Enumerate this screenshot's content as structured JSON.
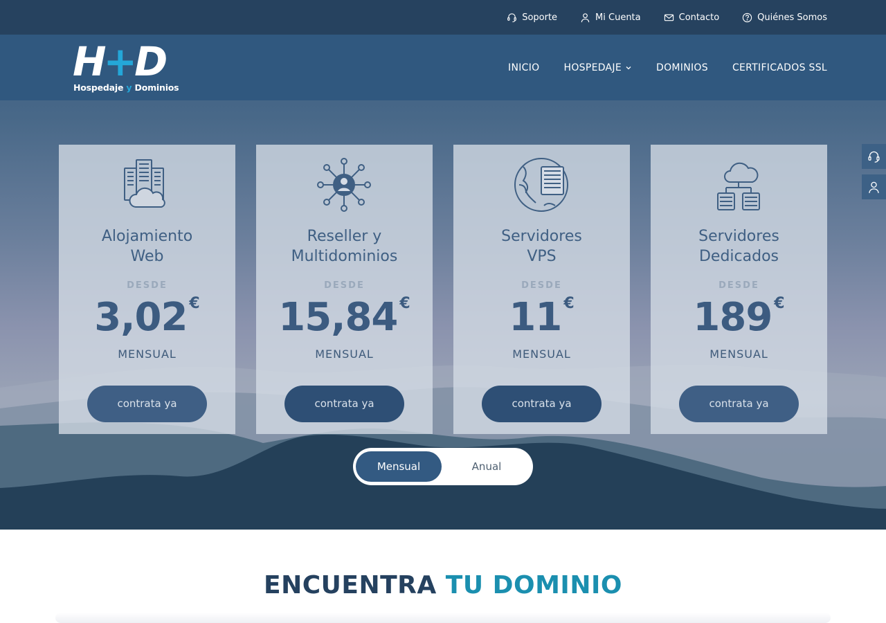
{
  "topbar": {
    "links": [
      {
        "label": "Soporte",
        "icon": "headset-icon"
      },
      {
        "label": "Mi Cuenta",
        "icon": "user-icon"
      },
      {
        "label": "Contacto",
        "icon": "envelope-icon"
      },
      {
        "label": "Quiénes Somos",
        "icon": "question-circle-icon"
      }
    ]
  },
  "header": {
    "logo": {
      "mark_left": "H",
      "mark_plus": "+",
      "mark_right": "D",
      "sub_a": "Hospedaje ",
      "sub_y": "y",
      "sub_b": " Dominios"
    },
    "nav": [
      {
        "label": "INICIO"
      },
      {
        "label": "HOSPEDAJE",
        "has_dropdown": true
      },
      {
        "label": "DOMINIOS"
      },
      {
        "label": "CERTIFICADOS SSL"
      }
    ]
  },
  "side_buttons": [
    {
      "icon": "headset-icon"
    },
    {
      "icon": "user-icon"
    }
  ],
  "plans": [
    {
      "title_1": "Alojamiento",
      "title_2": "Web",
      "desde": "DESDE",
      "price": "3,02",
      "currency": "€",
      "period": "MENSUAL",
      "cta": "contrata ya",
      "icon": "building-cloud-icon"
    },
    {
      "title_1": "Reseller y",
      "title_2": "Multidominios",
      "desde": "DESDE",
      "price": "15,84",
      "currency": "€",
      "period": "MENSUAL",
      "cta": "contrata ya",
      "icon": "user-network-icon"
    },
    {
      "title_1": "Servidores",
      "title_2": "VPS",
      "desde": "DESDE",
      "price": "11",
      "currency": "€",
      "period": "MENSUAL",
      "cta": "contrata ya",
      "icon": "globe-server-icon"
    },
    {
      "title_1": "Servidores",
      "title_2": "Dedicados",
      "desde": "DESDE",
      "price": "189",
      "currency": "€",
      "period": "MENSUAL",
      "cta": "contrata ya",
      "icon": "cloud-servers-icon"
    }
  ],
  "billing_toggle": {
    "active": "Mensual",
    "inactive": "Anual"
  },
  "domain_section": {
    "title_a": "ENCUENTRA ",
    "title_b": "TU DOMINIO"
  },
  "colors": {
    "topbar": "#26425f",
    "header": "#30587f",
    "accent": "#1b8faf",
    "card_text": "#3f5f83",
    "button": "#3f5f85"
  }
}
